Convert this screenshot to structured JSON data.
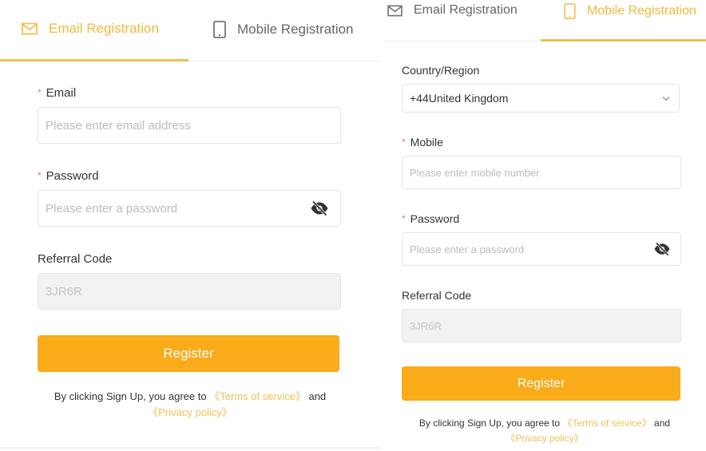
{
  "colors": {
    "accent": "#f0b93e",
    "button": "#f9ab1a",
    "required": "#e4737f",
    "link": "#f0bf5a"
  },
  "panels": [
    {
      "tabs": [
        {
          "label": "Email Registration",
          "icon": "envelope-icon",
          "active": true
        },
        {
          "label": "Mobile Registration",
          "icon": "mobile-phone-icon",
          "active": false
        }
      ],
      "email": {
        "label": "Email",
        "required": "*",
        "placeholder": "Please enter email address",
        "value": ""
      },
      "password": {
        "label": "Password",
        "required": "*",
        "placeholder": "Please enter a password",
        "value": "",
        "toggle_icon": "eye-slash-icon"
      },
      "referral": {
        "label": "Referral Code",
        "value": "3JR6R"
      },
      "register_label": "Register",
      "agreement": {
        "prefix": "By clicking Sign Up, you agree to ",
        "terms": "《Terms of service》",
        "and": " and ",
        "privacy": "《Privacy policy》"
      }
    },
    {
      "tabs": [
        {
          "label": "Email Registration",
          "icon": "envelope-icon",
          "active": false
        },
        {
          "label": "Mobile Registration",
          "icon": "mobile-phone-icon",
          "active": true
        }
      ],
      "country": {
        "label": "Country/Region",
        "value": "+44United Kingdom",
        "icon": "chevron-down-icon"
      },
      "mobile": {
        "label": "Mobile",
        "required": "*",
        "placeholder": "Please enter mobile number",
        "value": ""
      },
      "password": {
        "label": "Password",
        "required": "*",
        "placeholder": "Please enter a password",
        "value": "",
        "toggle_icon": "eye-slash-icon"
      },
      "referral": {
        "label": "Referral Code",
        "value": "3JR6R"
      },
      "register_label": "Register",
      "agreement": {
        "prefix": "By clicking Sign Up, you agree to ",
        "terms": "《Terms of service》",
        "and": " and ",
        "privacy": "《Privacy policy》"
      }
    }
  ]
}
